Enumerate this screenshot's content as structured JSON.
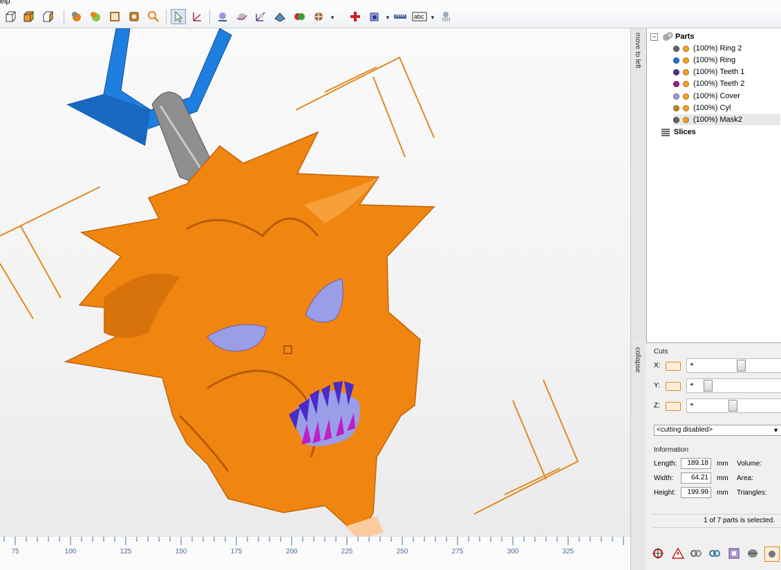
{
  "menu": {
    "help_fragment": "elp"
  },
  "tree": {
    "root_label": "Parts",
    "parts": [
      {
        "label": "(100%) Ring 2",
        "color": "#666666"
      },
      {
        "label": "(100%) Ring",
        "color": "#1e6fd0"
      },
      {
        "label": "(100%) Teeth 1",
        "color": "#5a2aa0"
      },
      {
        "label": "(100%) Teeth 2",
        "color": "#9a1e8c"
      },
      {
        "label": "(100%) Cover",
        "color": "#9f97e0"
      },
      {
        "label": "(100%) Cyl",
        "color": "#c8851e"
      },
      {
        "label": "(100%) Mask2",
        "color": "#666666"
      }
    ],
    "slices_label": "Slices"
  },
  "side_tabs": {
    "top": "move to left",
    "bottom": "collapse"
  },
  "cuts": {
    "title": "Cuts",
    "x_label": "X:",
    "y_label": "Y:",
    "z_label": "Z:",
    "x_level": 0.48,
    "y_level": 0.08,
    "z_level": 0.38,
    "mode": "<cutting disabled>"
  },
  "information": {
    "title": "Information",
    "length_label": "Length:",
    "length_value": "189.18",
    "width_label": "Width:",
    "width_value": "64.21",
    "height_label": "Height:",
    "height_value": "199.99",
    "unit": "mm",
    "volume_label": "Volume:",
    "area_label": "Area:",
    "triangles_label": "Triangles:"
  },
  "status": "1 of 7 parts is selected.",
  "ruler": {
    "labels": [
      "75",
      "100",
      "125",
      "150",
      "175",
      "200",
      "225",
      "250",
      "275",
      "300",
      "325"
    ]
  },
  "colors": {
    "model_orange": "#f0860f",
    "ring_blue": "#1f7fe0",
    "eye_purple": "#9a9ee8",
    "frame_orange": "#e08a1e"
  }
}
